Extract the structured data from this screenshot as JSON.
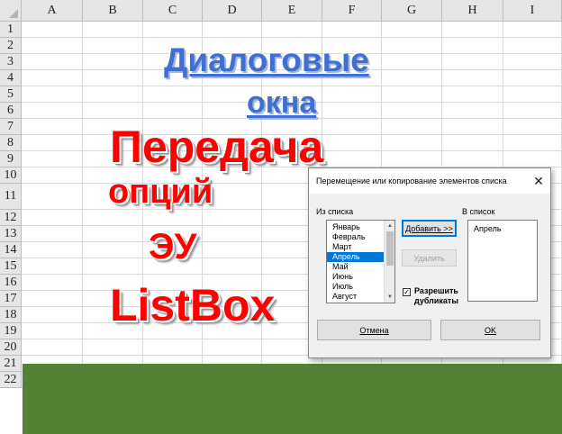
{
  "sheet": {
    "columns": [
      "A",
      "B",
      "C",
      "D",
      "E",
      "F",
      "G",
      "H",
      "I"
    ],
    "rows": [
      "1",
      "2",
      "3",
      "4",
      "5",
      "6",
      "7",
      "8",
      "9",
      "10",
      "11",
      "12",
      "13",
      "14",
      "15",
      "16",
      "17",
      "18",
      "19",
      "20",
      "21",
      "22"
    ],
    "band_color": "#548235"
  },
  "wordart": {
    "line1": "Диалоговые",
    "line2": "окна",
    "line3": "Передача",
    "line4": "опций",
    "line5": "ЭУ",
    "line6": "ListBox",
    "blue": "#3f6fd3",
    "red": "#ff0000"
  },
  "dialog": {
    "title": "Перемещение или копирование элементов списка",
    "close_glyph": "✕",
    "source_label": "Из списка",
    "source_items": [
      "Январь",
      "Февраль",
      "Март",
      "Апрель",
      "Май",
      "Июнь",
      "Июль",
      "Август"
    ],
    "source_selected": "Апрель",
    "target_label": "В список",
    "target_items": [
      "Апрель"
    ],
    "add_button": "Добавить >>",
    "remove_button": "Удалить",
    "allow_duplicates_label_line1": "Разрешить",
    "allow_duplicates_label_line2": "дубликаты",
    "allow_duplicates_checked": true,
    "cancel_button": "Отмена",
    "ok_button": "OK",
    "accent": "#0078d7"
  }
}
